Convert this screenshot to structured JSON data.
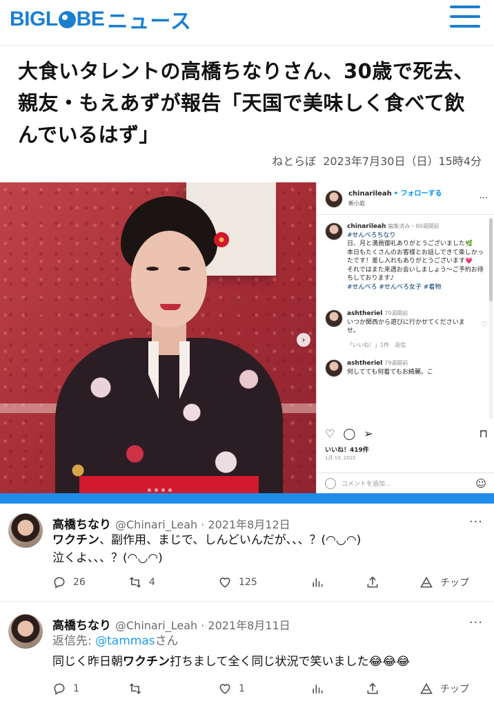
{
  "header": {
    "logo_brand_left": "BIGL",
    "logo_brand_right": "BE",
    "logo_news": "ニュース",
    "accent": "#1b7fd0"
  },
  "article": {
    "title": "大食いタレントの高橋ちなりさん、30歳で死去、親友・もえあずが報告「天国で美味しく食べて飲んでいるはず」",
    "source": "ねとらぼ",
    "date": "2023年7月30日（日）15時4分"
  },
  "instagram": {
    "username": "chinarileah",
    "follow": "• フォローする",
    "location": "新小岩",
    "post_author": "chinarileah",
    "post_meta": "編集済み・80週間前",
    "post_lines": [
      "#せんべろちなり",
      "日、月と満員御礼ありがとうございました🌿",
      "本日もたくさんのお客様とお話しできて楽しかったです！差し入れもありがとうございます💗",
      "それではまた来週お会いしましょう〜ご予約お待ちしております♪",
      "#せんべろ #せんべろ女子 #着物"
    ],
    "comment1_author": "ashtheriel",
    "comment1_ago": "79週間前",
    "comment1_text": "いつか関西から遊びに行かせてくださいませ。",
    "comment1_sub": "「いいね！」1件　返信",
    "comment2_author": "ashtheriel",
    "comment2_ago": "79週間前",
    "comment2_text": "何してても何着てもお綺麗。こ",
    "likes": "いいね！419件",
    "date": "1月 10, 2022",
    "add_comment": "コメントを追加..."
  },
  "tweets": [
    {
      "name": "高橋ちなり",
      "handle": "@Chinari_Leah · 2021年8月12日",
      "text_bold": "ワクチン",
      "text_rest": "、副作用、まじで、しんどいんだが、、、？(◠◡◠)",
      "text_line2": "泣くよ、、、？(◠◡◠)",
      "replies": "26",
      "retweets": "4",
      "likes": "125",
      "tip": "チップ"
    },
    {
      "name": "高橋ちなり",
      "handle": "@Chinari_Leah · 2021年8月11日",
      "reply_prefix": "返信先: ",
      "reply_mention": "@tammas",
      "reply_suffix": "さん",
      "text_pre": "同じく昨日朝",
      "text_bold": "ワクチン",
      "text_post": "打ちまして全く同じ状況で笑いました😂😂😂",
      "replies": "1",
      "retweets": "",
      "likes": "1",
      "tip": "チップ"
    }
  ]
}
